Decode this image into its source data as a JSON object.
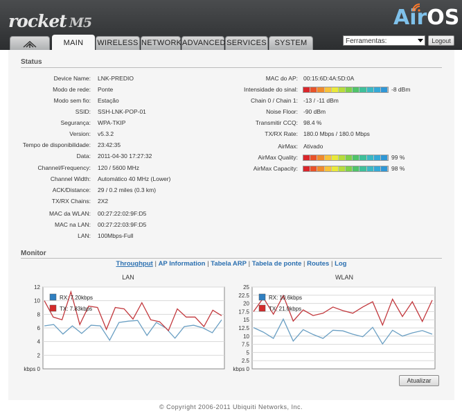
{
  "brand": {
    "logo_text": "rocket",
    "model": "M5",
    "airos_air": "Air",
    "airos_os": "OS"
  },
  "tabs": [
    "MAIN",
    "WIRELESS",
    "NETWORK",
    "ADVANCED",
    "SERVICES",
    "SYSTEM"
  ],
  "tools": {
    "label": "Ferramentas:",
    "logout": "Logout"
  },
  "status": {
    "title": "Status",
    "left": [
      {
        "label": "Device Name:",
        "value": "LNK-PREDIO"
      },
      {
        "label": "Modo de rede:",
        "value": "Ponte"
      },
      {
        "label": "Modo sem fio:",
        "value": "Estação"
      },
      {
        "label": "SSID:",
        "value": "SSH-LNK-POP-01"
      },
      {
        "label": "Segurança:",
        "value": "WPA-TKIP"
      },
      {
        "label": "Version:",
        "value": "v5.3.2"
      },
      {
        "label": "Tempo de disponibilidade:",
        "value": "23:42:35"
      },
      {
        "label": "Data:",
        "value": "2011-04-30 17:27:32"
      },
      {
        "label": "Channel/Frequency:",
        "value": "120  /  5600 MHz"
      },
      {
        "label": "Channel Width:",
        "value": "Automático 40 MHz  (Lower)"
      },
      {
        "label": "ACK/Distance:",
        "value": "29 / 0.2 miles (0.3 km)"
      },
      {
        "label": "TX/RX Chains:",
        "value": "2X2"
      },
      {
        "label": "MAC da WLAN:",
        "value": "00:27:22:02:9F:D5"
      },
      {
        "label": "MAC na LAN:",
        "value": "00:27:22:03:9F:D5"
      },
      {
        "label": "LAN:",
        "value": "100Mbps-Full"
      }
    ],
    "right": [
      {
        "label": "MAC do AP:",
        "value": "00:15:6D:4A:5D:0A"
      },
      {
        "label": "Intensidade do sinal:",
        "value": "-8 dBm",
        "bar": 1.0
      },
      {
        "label": "Chain 0 / Chain 1:",
        "value": "-13  /  -11  dBm"
      },
      {
        "label": "Noise Floor:",
        "value": "-90 dBm"
      },
      {
        "label": "Transmitir CCQ:",
        "value": "98.4 %"
      },
      {
        "label": "TX/RX Rate:",
        "value": "180.0 Mbps  /  180.0 Mbps"
      },
      {
        "label": "AirMax:",
        "value": "Ativado"
      },
      {
        "label": "AirMax Quality:",
        "value": "99  %",
        "bar": 0.99
      },
      {
        "label": "AirMax Capacity:",
        "value": "98  %",
        "bar": 0.98
      }
    ]
  },
  "monitor": {
    "title": "Monitor",
    "links": [
      "Throughput",
      "AP Information",
      "Tabela ARP",
      "Tabela de ponte",
      "Routes",
      "Log"
    ],
    "refresh": "Atualizar"
  },
  "colors": {
    "rx": "#2f7fc1",
    "tx": "#d42a2a",
    "rx_line": "#6a9fc3",
    "tx_line": "#c2383d"
  },
  "chart_data": [
    {
      "type": "line",
      "title": "LAN",
      "ylabel": "kbps",
      "ylim": [
        0,
        12
      ],
      "yticks": [
        0,
        2,
        4,
        6,
        8,
        10,
        12
      ],
      "grid": true,
      "legend": "top-left",
      "series": [
        {
          "name": "RX: 7.20kbps",
          "values": [
            6.3,
            6.5,
            5.1,
            6.3,
            5.2,
            6.4,
            6.3,
            4.2,
            6.8,
            7.0,
            7.1,
            4.9,
            6.8,
            6.0,
            4.5,
            6.2,
            6.4,
            6.0,
            5.3,
            7.2
          ]
        },
        {
          "name": "TX: 7.83kbps",
          "values": [
            10.0,
            7.6,
            7.2,
            11.3,
            6.5,
            9.2,
            9.0,
            5.8,
            9.0,
            8.8,
            7.3,
            9.7,
            7.2,
            6.9,
            5.6,
            8.8,
            7.6,
            7.6,
            6.2,
            8.6,
            7.8
          ]
        }
      ]
    },
    {
      "type": "line",
      "title": "WLAN",
      "ylabel": "kbps",
      "ylim": [
        0,
        25
      ],
      "yticks": [
        0,
        2.5,
        5,
        7.5,
        10,
        12.5,
        15,
        17.5,
        20,
        22.5,
        25
      ],
      "grid": true,
      "legend": "top-left",
      "series": [
        {
          "name": "RX: 10.6kbps",
          "values": [
            12.6,
            11.2,
            9.3,
            15.2,
            8.5,
            12.0,
            10.5,
            9.3,
            11.8,
            11.6,
            10.6,
            9.8,
            12.7,
            7.6,
            11.8,
            10.0,
            11.0,
            11.7,
            10.6
          ]
        },
        {
          "name": "TX: 21.0kbps",
          "values": [
            17.5,
            21.7,
            16.7,
            22.4,
            14.6,
            18.0,
            16.3,
            17.0,
            18.9,
            17.8,
            17.0,
            18.9,
            20.5,
            13.4,
            21.3,
            16.0,
            20.5,
            14.5,
            21.0
          ]
        }
      ]
    }
  ],
  "footer": "© Copyright 2006-2011 Ubiquiti Networks, Inc."
}
